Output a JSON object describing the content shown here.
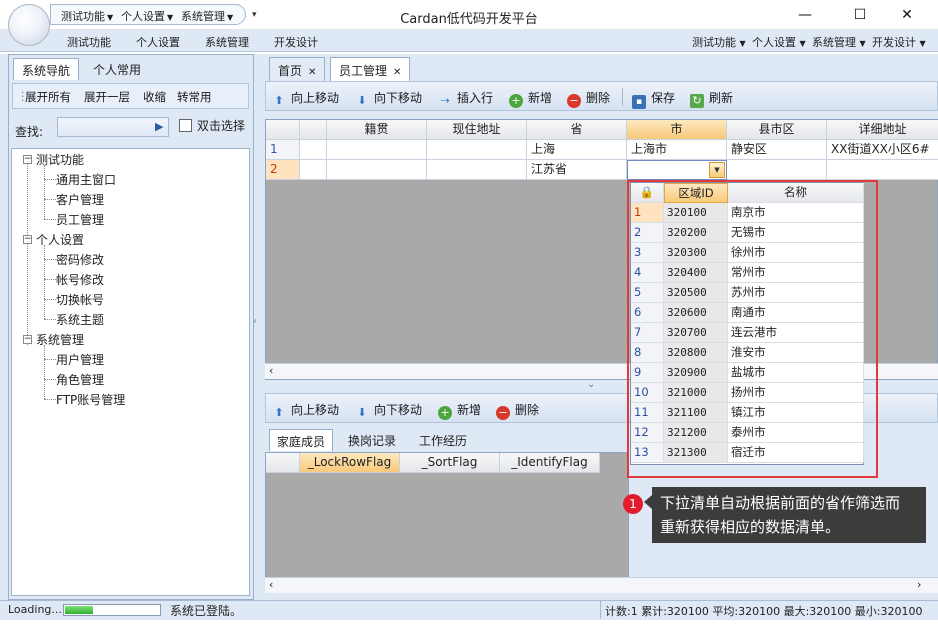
{
  "title": "Cardan低代码开发平台",
  "qat": {
    "items": [
      "测试功能",
      "个人设置",
      "系统管理"
    ]
  },
  "window_buttons": {
    "minimize": "—",
    "maximize": "☐",
    "close": "✕"
  },
  "menu": {
    "left": [
      "测试功能",
      "个人设置",
      "系统管理",
      "开发设计"
    ],
    "right": [
      "测试功能",
      "个人设置",
      "系统管理",
      "开发设计"
    ]
  },
  "nav": {
    "tabs": [
      "系统导航",
      "个人常用"
    ],
    "toolbar": [
      "展开所有",
      "展开一层",
      "收缩",
      "转常用"
    ],
    "search_label": "查找:",
    "double_click_label": "双击选择",
    "tree": [
      {
        "label": "测试功能",
        "children": [
          "通用主窗口",
          "客户管理",
          "员工管理"
        ]
      },
      {
        "label": "个人设置",
        "children": [
          "密码修改",
          "帐号修改",
          "切换帐号",
          "系统主题"
        ]
      },
      {
        "label": "系统管理",
        "children": [
          "用户管理",
          "角色管理",
          "FTP账号管理"
        ]
      }
    ]
  },
  "doc_tabs": [
    "首页",
    "员工管理"
  ],
  "toolbar_main": {
    "up": "向上移动",
    "down": "向下移动",
    "insert": "插入行",
    "add": "新增",
    "delete": "删除",
    "save": "保存",
    "refresh": "刷新"
  },
  "grid1": {
    "columns": [
      "籍贯",
      "现住地址",
      "省",
      "市",
      "县市区",
      "详细地址"
    ],
    "rows": [
      {
        "num": "1",
        "cells": [
          "",
          "",
          "上海",
          "上海市",
          "静安区",
          "XX街道XX小区6#"
        ]
      },
      {
        "num": "2",
        "cells": [
          "",
          "",
          "江苏省",
          "",
          "",
          ""
        ]
      }
    ],
    "active_column": "市"
  },
  "dropdown": {
    "columns": [
      "区域ID",
      "名称"
    ],
    "rows": [
      {
        "num": "1",
        "id": "320100",
        "name": "南京市"
      },
      {
        "num": "2",
        "id": "320200",
        "name": "无锡市"
      },
      {
        "num": "3",
        "id": "320300",
        "name": "徐州市"
      },
      {
        "num": "4",
        "id": "320400",
        "name": "常州市"
      },
      {
        "num": "5",
        "id": "320500",
        "name": "苏州市"
      },
      {
        "num": "6",
        "id": "320600",
        "name": "南通市"
      },
      {
        "num": "7",
        "id": "320700",
        "name": "连云港市"
      },
      {
        "num": "8",
        "id": "320800",
        "name": "淮安市"
      },
      {
        "num": "9",
        "id": "320900",
        "name": "盐城市"
      },
      {
        "num": "10",
        "id": "321000",
        "name": "扬州市"
      },
      {
        "num": "11",
        "id": "321100",
        "name": "镇江市"
      },
      {
        "num": "12",
        "id": "321200",
        "name": "泰州市"
      },
      {
        "num": "13",
        "id": "321300",
        "name": "宿迁市"
      }
    ]
  },
  "tooltip": {
    "badge": "1",
    "text_line1": "下拉清单自动根据前面的省作筛选而",
    "text_line2": "重新获得相应的数据清单。"
  },
  "toolbar_sub": {
    "up": "向上移动",
    "down": "向下移动",
    "add": "新增",
    "delete": "删除"
  },
  "sub_tabs": [
    "家庭成员",
    "换岗记录",
    "工作经历"
  ],
  "grid2": {
    "columns": [
      "_LockRowFlag",
      "_SortFlag",
      "_IdentifyFlag"
    ]
  },
  "status": {
    "loading": "Loading...",
    "progress": 0.3,
    "message": "系统已登陆。",
    "stats": "计数:1 累计:320100 平均:320100 最大:320100 最小:320100"
  },
  "colors": {
    "accent": "#dfe8f5",
    "highlight": "#f8c97a",
    "outline": "#e23a3a",
    "tooltip_bg": "#3c3c3c"
  }
}
